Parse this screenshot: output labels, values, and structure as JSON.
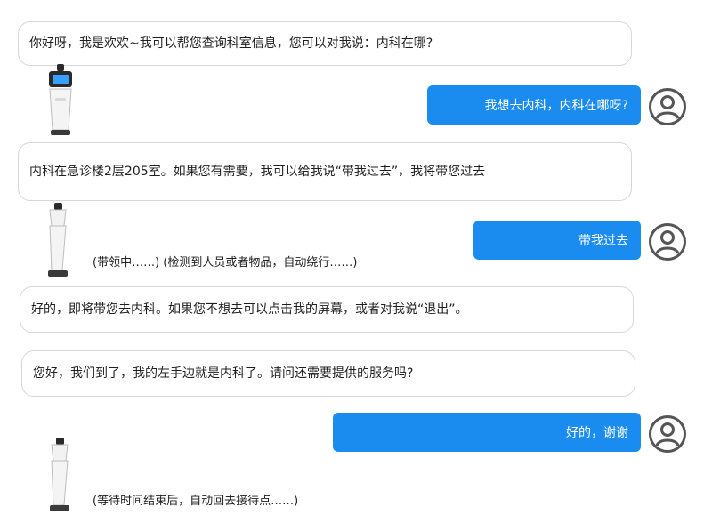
{
  "messages": {
    "bot_1": "你好呀，我是欢欢~我可以帮您查询科室信息，您可以对我说：内科在哪?",
    "user_1": "我想去内科，内科在哪呀?",
    "bot_2": "内科在急诊楼2层205室。如果您有需要，我可以给我说“带我过去”，我将带您过去",
    "user_2": "带我过去",
    "status_1": "(带领中……) (检测到人员或者物品，自动绕行……)",
    "bot_3": "好的，即将带您去内科。如果您不想去可以点击我的屏幕，或者对我说“退出”。",
    "bot_4": "您好，我们到了，我的左手边就是内科了。请问还需要提供的服务吗?",
    "user_3": "好的，谢谢",
    "status_2": "(等待时间结束后，自动回去接待点……)"
  },
  "colors": {
    "user_bubble": "#1a8cf0",
    "bot_border": "#d7d7d7",
    "avatar_stroke": "#555555"
  },
  "icons": [
    "robot-front-icon",
    "robot-side-icon",
    "user-avatar-icon"
  ]
}
